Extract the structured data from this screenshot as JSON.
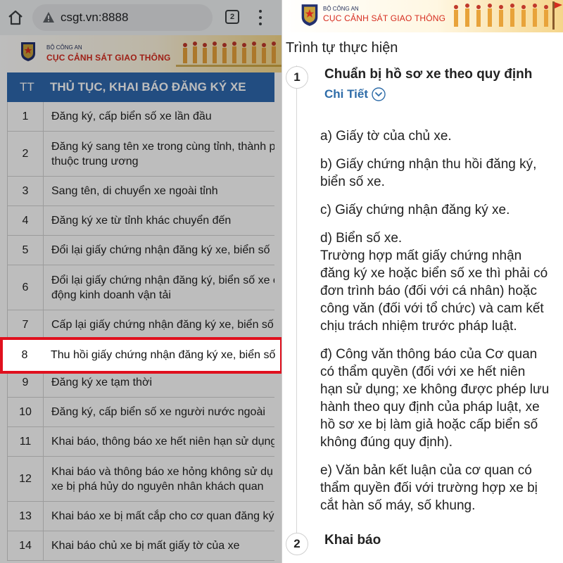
{
  "left": {
    "browser": {
      "url": "csgt.vn:8888",
      "tab_count": "2",
      "icons": {
        "home": "home-icon",
        "warning": "warning-icon",
        "menu": "kebab-menu-icon"
      }
    },
    "banner": {
      "ministry": "BỘ CÔNG AN",
      "department": "CỤC CẢNH SÁT GIAO THÔNG"
    },
    "table": {
      "col_tt": "TT",
      "col_title": "THỦ TỤC, KHAI BÁO ĐĂNG KÝ XE",
      "rows_top": [
        {
          "num": "1",
          "lines": [
            "Đăng ký, cấp biển số xe lần đầu"
          ]
        },
        {
          "num": "2",
          "lines": [
            "Đăng ký sang tên xe trong cùng tỉnh, thành p",
            "thuộc trung ương"
          ]
        },
        {
          "num": "3",
          "lines": [
            "Sang tên, di chuyển xe ngoài tỉnh"
          ]
        },
        {
          "num": "4",
          "lines": [
            "Đăng ký xe từ tỉnh khác chuyển đến"
          ]
        },
        {
          "num": "5",
          "lines": [
            "Đổi lại giấy chứng nhận đăng ký xe, biển số"
          ]
        },
        {
          "num": "6",
          "lines": [
            "Đổi lại giấy chứng nhận đăng ký, biển số xe c",
            "động kinh doanh vận tải"
          ]
        },
        {
          "num": "7",
          "lines": [
            "Cấp lại giấy chứng nhận đăng ký xe, biển số"
          ]
        }
      ],
      "highlighted": {
        "num": "8",
        "text": "Thu hồi giấy chứng nhận đăng ký xe, biển số"
      },
      "rows_bottom": [
        {
          "num": "9",
          "lines": [
            "Đăng ký xe tạm thời"
          ]
        },
        {
          "num": "10",
          "lines": [
            "Đăng ký, cấp biển số xe người nước ngoài"
          ]
        },
        {
          "num": "11",
          "lines": [
            "Khai báo, thông báo xe hết niên hạn sử dụng"
          ]
        },
        {
          "num": "12",
          "lines": [
            "Khai báo và thông báo xe hỏng không sử dụ",
            "xe bị phá hủy do nguyên nhân khách quan"
          ]
        },
        {
          "num": "13",
          "lines": [
            "Khai báo xe bị mất cắp cho cơ quan đăng ký"
          ]
        },
        {
          "num": "14",
          "lines": [
            "Khai báo chủ xe bị mất giấy tờ của xe"
          ]
        }
      ]
    }
  },
  "right": {
    "banner": {
      "ministry": "BỘ CÔNG AN",
      "department": "CỤC CẢNH SÁT GIAO THÔNG"
    },
    "section_title": "Trình tự thực hiện",
    "steps": [
      {
        "number": "1",
        "title": "Chuẩn bị hồ sơ xe theo quy định"
      },
      {
        "number": "2",
        "title": "Khai báo"
      }
    ],
    "detail_link": "Chi Tiết",
    "content": {
      "a": "a) Giấy tờ của chủ xe.",
      "b": "b) Giấy chứng nhận thu hồi đăng ký,\nbiển số xe.",
      "c": "c) Giấy chứng nhận đăng ký xe.",
      "d": "d) Biển số xe.\nTrường hợp mất giấy chứng nhận\nđăng ký xe hoặc biển số xe thì phải có\nđơn trình báo (đối với cá nhân) hoặc\ncông văn (đối với tổ chức) và cam kết\nchịu trách nhiệm trước pháp luật.",
      "dd": "đ) Công văn thông báo của Cơ quan\ncó thẩm quyền (đối với xe hết niên\nhạn sử dụng; xe không được phép lưu\nhành theo quy định của pháp luật, xe\nhồ sơ xe bị làm giả hoặc cấp biển số\nkhông đúng quy định).",
      "e": "e) Văn bản kết luận của cơ quan có\nthẩm quyền đối với trường hợp xe bị\ncắt hàn số máy, số khung."
    }
  }
}
